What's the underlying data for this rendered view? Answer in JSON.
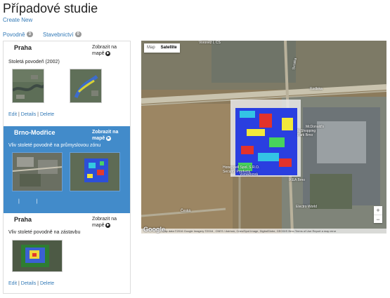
{
  "page": {
    "title": "Případové studie",
    "create_new": "Create New"
  },
  "tabs": [
    {
      "label": "Povodně",
      "count": "3"
    },
    {
      "label": "Stavebnictví",
      "count": "0"
    }
  ],
  "cases": [
    {
      "title": "Praha",
      "map_link": "Zobrazit na mapě",
      "desc": "Stoletá povodeň (2002)",
      "actions": [
        "Edit",
        "Details",
        "Delete"
      ]
    },
    {
      "title": "Brno-Modřice",
      "map_link": "Zobrazit na mapě",
      "desc": "Vliv stoleté povodně na průmyslovou zónu",
      "ticks": [
        "|",
        "|"
      ]
    },
    {
      "title": "Praha",
      "map_link": "Zobrazit na mapě",
      "desc": "Vliv stoleté povodně na zástavbu",
      "actions": [
        "Edit",
        "Details",
        "Delete"
      ]
    }
  ],
  "map": {
    "type_map": "Map",
    "type_satellite": "Satellite",
    "zoom_in": "+",
    "zoom_out": "−",
    "footer": "Map data ©2016 Google Imagery ©2016 , CNES / Astrium, Cnes/Spot Image, DigitalGlobe, GEODIS Brno   Terms of Use   Report a map error",
    "google": "Google",
    "labels": {
      "vomacka": "Vomáčková",
      "honeywell": "Honeywell Spol. S R.O.",
      "security": "Security Products",
      "shopping": "N Shopping",
      "park": "Park Brno",
      "mcdonalds": "McDonald's",
      "ikea": "IKEA Brno",
      "electro": "Electro World",
      "svratka": "Svratka",
      "ceska": "Česká",
      "voronez": "Voroněž I, CS",
      "road": "Rzdlska"
    }
  }
}
